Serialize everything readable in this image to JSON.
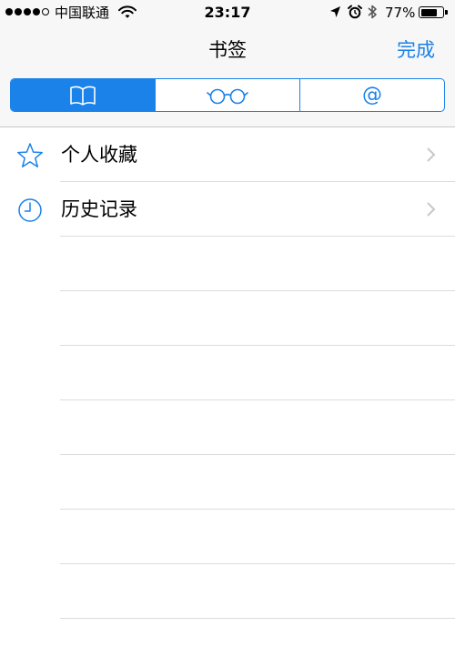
{
  "status_bar": {
    "carrier": "中国联通",
    "time": "23:17",
    "battery_percent": "77%",
    "battery_level": 0.77,
    "signal_bars_filled": 4,
    "signal_bars_total": 5,
    "icons": [
      "wifi-icon",
      "location-arrow-icon",
      "alarm-clock-icon",
      "bluetooth-icon",
      "battery-icon"
    ]
  },
  "nav": {
    "title": "书签",
    "done_label": "完成"
  },
  "segments": {
    "items": [
      {
        "name": "bookmarks",
        "icon": "book-icon",
        "selected": true
      },
      {
        "name": "reading-list",
        "icon": "glasses-icon",
        "selected": false
      },
      {
        "name": "shared-links",
        "icon": "at-sign-icon",
        "label": "@",
        "selected": false
      }
    ]
  },
  "list": {
    "items": [
      {
        "label": "个人收藏",
        "icon": "star-icon"
      },
      {
        "label": "历史记录",
        "icon": "clock-icon"
      }
    ]
  },
  "colors": {
    "accent": "#1a82e8",
    "bar_background": "#f7f7f7",
    "separator": "#dcdcde",
    "chevron": "#c7c7cc"
  }
}
